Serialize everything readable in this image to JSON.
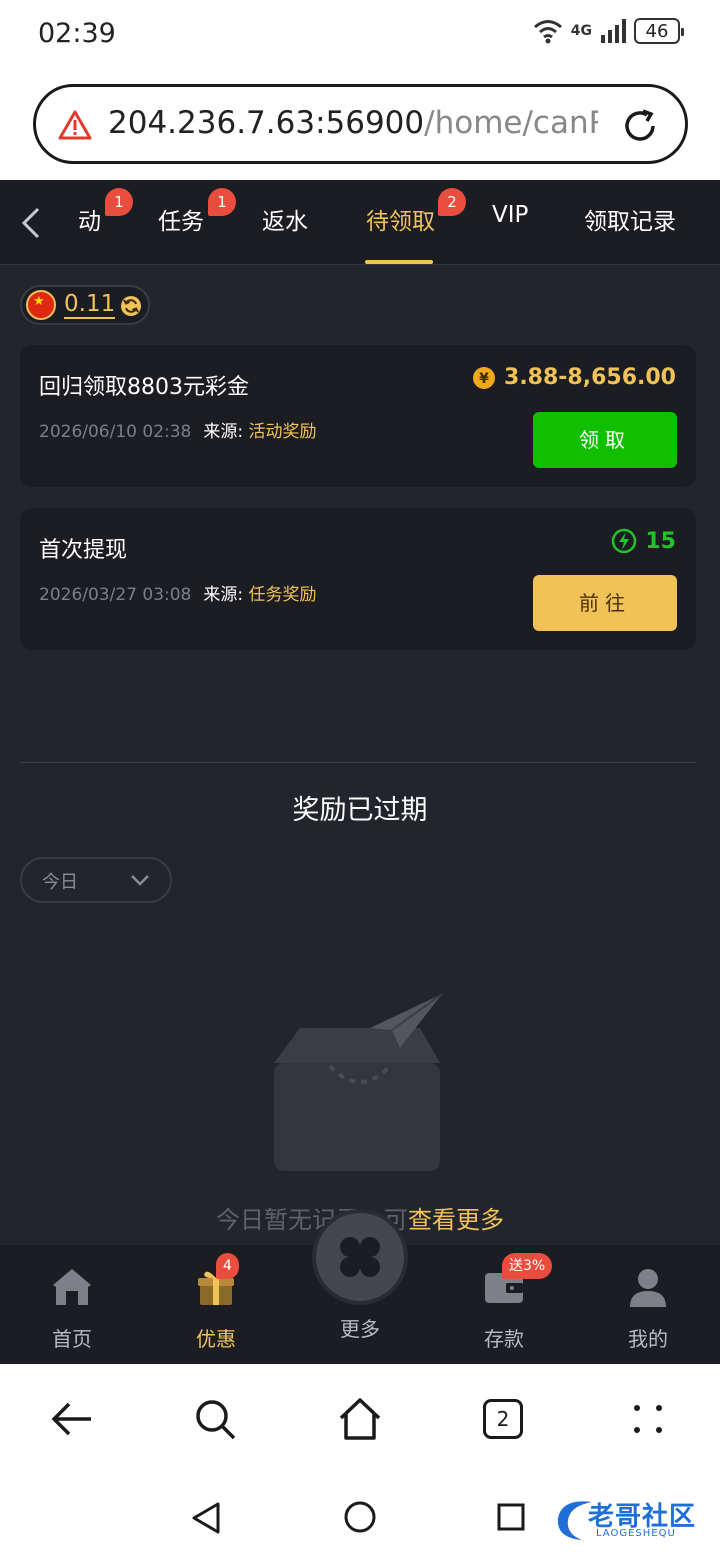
{
  "status_bar": {
    "time": "02:39",
    "network": "4G",
    "battery": "46"
  },
  "browser": {
    "url_host": "204.236.7.63:56900",
    "url_path": "/home/canRec",
    "tab_count": "2"
  },
  "tabs": [
    {
      "label": "动",
      "badge": "1"
    },
    {
      "label": "任务",
      "badge": "1"
    },
    {
      "label": "返水",
      "badge": ""
    },
    {
      "label": "待领取",
      "badge": "2",
      "active": true
    },
    {
      "label": "VIP",
      "badge": ""
    },
    {
      "label": "领取记录",
      "badge": ""
    }
  ],
  "balance": {
    "amount": "0.11"
  },
  "rewards": [
    {
      "title": "回归领取8803元彩金",
      "amount": "3.88-8,656.00",
      "date": "2026/06/10 02:38",
      "source_label": "来源:",
      "source": "活动奖励",
      "button": "领取",
      "amount_color": "#f0c258",
      "icon": "yen-coin-icon"
    },
    {
      "title": "首次提现",
      "amount": "15",
      "date": "2026/03/27 03:08",
      "source_label": "来源:",
      "source": "任务奖励",
      "button": "前往",
      "amount_color": "#1fc42a",
      "icon": "lightning-icon"
    }
  ],
  "expired": {
    "title": "奖励已过期",
    "filter_value": "今日",
    "empty_text": "今日暂无记录，可",
    "view_more": "查看更多"
  },
  "bottom_nav": [
    {
      "label": "首页",
      "icon": "home-icon"
    },
    {
      "label": "优惠",
      "icon": "gift-icon",
      "badge": "4",
      "active": true
    },
    {
      "label": "更多",
      "icon": "clover-icon"
    },
    {
      "label": "存款",
      "icon": "wallet-icon",
      "badge": "送3%"
    },
    {
      "label": "我的",
      "icon": "user-icon"
    }
  ],
  "watermark": {
    "text": "老哥社区",
    "sub": "LAOGESHEQU"
  },
  "colors": {
    "accent": "#f0c258",
    "bg": "#23252d",
    "card": "#1c1d22",
    "green": "#10c000",
    "badge": "#e84d3d"
  }
}
